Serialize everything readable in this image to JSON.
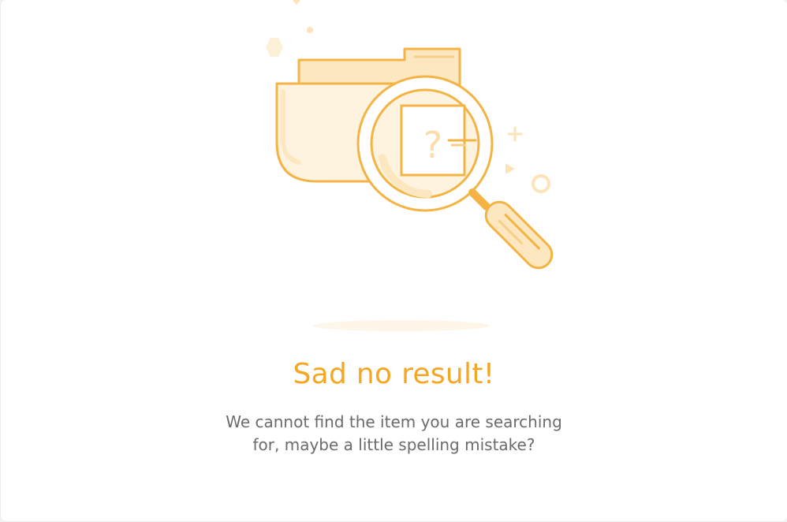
{
  "empty_state": {
    "title": "Sad no result!",
    "message_line1": "We cannot find the item you are searching",
    "message_line2": "for, maybe a little spelling mistake?",
    "illustration_icon": "folder-magnifier-icon",
    "question_mark": "?"
  },
  "colors": {
    "accent": "#f5a623",
    "stroke": "#f4b445",
    "fill_light": "#fef3df",
    "fill_mid": "#fde7c0",
    "text": "#6b6b6b",
    "background": "#ffffff"
  }
}
